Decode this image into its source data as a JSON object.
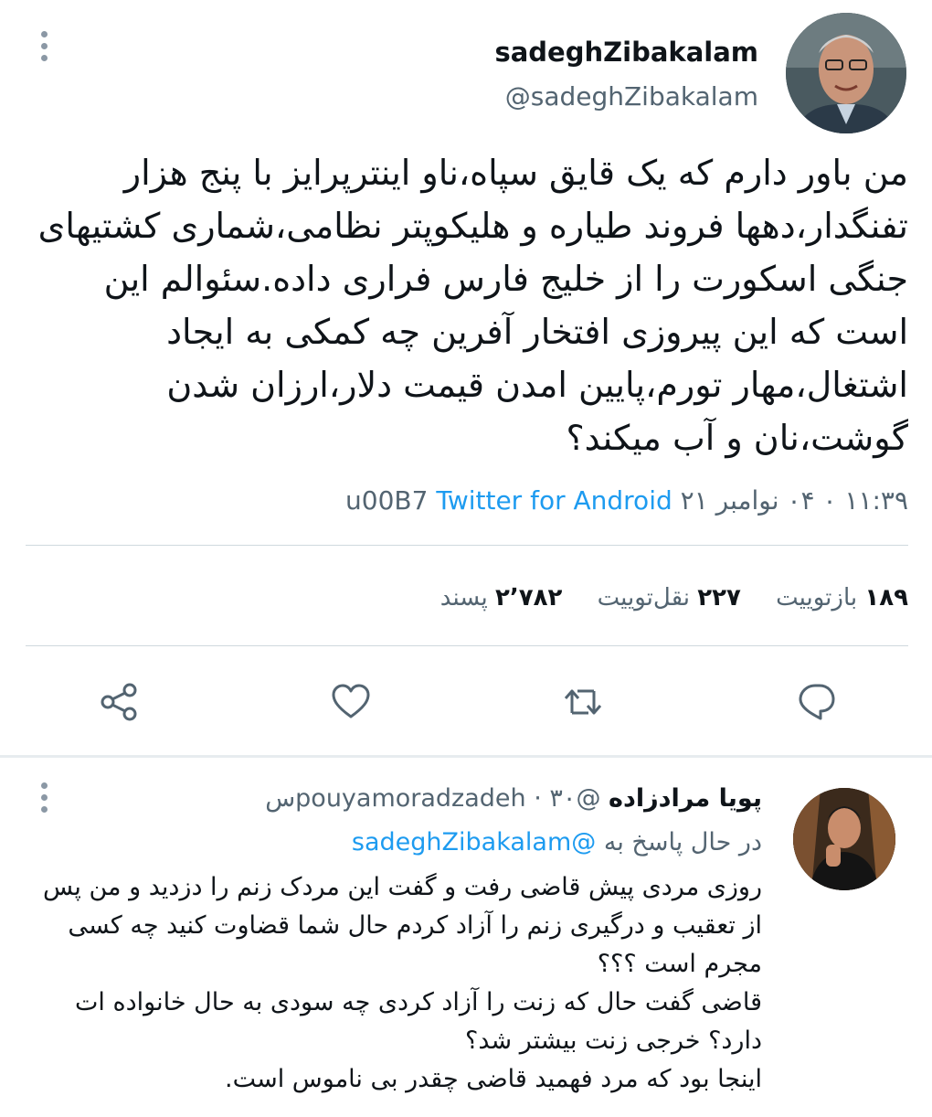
{
  "main_tweet": {
    "display_name": "sadeghZibakalam",
    "handle": "@sadeghZibakalam",
    "text": "من باور دارم که یک قایق سپاه،ناو اینترپرایز با پنج هزار تفنگدار،دهها فروند طیاره و هلیکوپتر نظامی،شماری کشتیهای جنگی اسکورت را از خلیج فارس فراری داده.سئوالم این است که این پیروزی افتخار آفرین چه کمکی به ایجاد اشتغال،مهار تورم،پایین امدن قیمت دلار،ارزان شدن گوشت،نان و آب میکند؟",
    "timestamp": "۱۱:۳۹ ۰ ۰۴ نوامبر ۲۱",
    "separator": "u00B7",
    "source": "Twitter for Android",
    "stats": {
      "retweets_count": "۱۸۹",
      "retweets_label": "بازتوییت",
      "quotes_count": "۲۲۷",
      "quotes_label": "نقل‌توییت",
      "likes_count": "۲٬۷۸۲",
      "likes_label": "پسند"
    }
  },
  "reply": {
    "display_name": "پویا مرادزاده",
    "handle": "@pouyamoradzadeh",
    "time": "۳۰س",
    "replying_prefix": "در حال پاسخ به",
    "replying_to": "@sadeghZibakalam",
    "lines": [
      "روزی مردی پیش قاضی رفت و گفت این مردک زنم را دزدید و من پس از تعقیب و درگیری زنم را آزاد کردم حال شما قضاوت کنید چه کسی مجرم است ؟؟؟",
      "قاضی گفت حال که زنت را آزاد کردی چه سودی به حال خانواده ات دارد؟ خرجی زنت بیشتر شد؟",
      "اینجا بود که مرد فهمید قاضی چقدر بی ناموس است."
    ]
  },
  "icons": [
    "more-icon",
    "share-icon",
    "like-icon",
    "retweet-icon",
    "reply-icon"
  ],
  "colors": {
    "accent": "#1d9bf0",
    "secondary_text": "#536471",
    "divider": "#cfd9de"
  }
}
